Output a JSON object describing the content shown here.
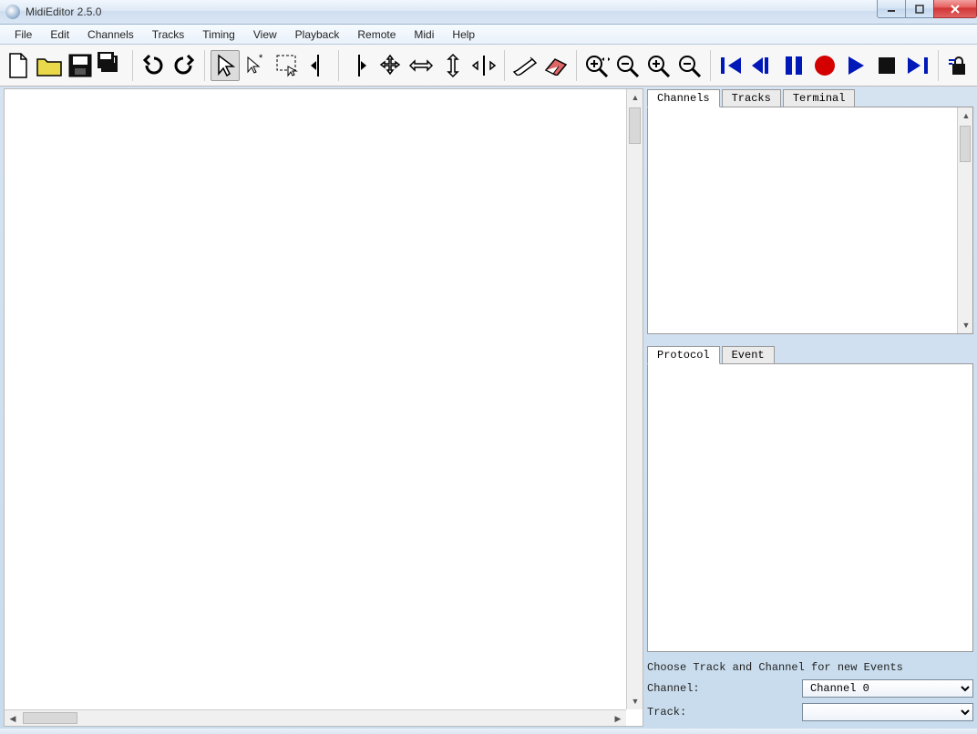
{
  "window": {
    "title": "MidiEditor 2.5.0"
  },
  "menu": [
    "File",
    "Edit",
    "Channels",
    "Tracks",
    "Timing",
    "View",
    "Playback",
    "Remote",
    "Midi",
    "Help"
  ],
  "toolbar": {
    "groups": [
      [
        "new",
        "open",
        "save",
        "save-all"
      ],
      [
        "undo",
        "redo"
      ],
      [
        "select",
        "select-add",
        "select-box",
        "select-left",
        "select-right"
      ],
      [
        "move",
        "move-h",
        "move-v",
        "move-cross"
      ],
      [
        "pencil",
        "eraser"
      ],
      [
        "zoom-in-h",
        "zoom-out-h",
        "zoom-in-v",
        "zoom-out-v"
      ],
      [
        "skip-start",
        "step-back",
        "pause",
        "record",
        "play",
        "stop",
        "skip-end"
      ],
      [
        "lock"
      ]
    ],
    "active": "select"
  },
  "tabs_upper": [
    "Channels",
    "Tracks",
    "Terminal"
  ],
  "tabs_upper_active": "Channels",
  "tabs_lower": [
    "Protocol",
    "Event"
  ],
  "tabs_lower_active": "Protocol",
  "form": {
    "caption": "Choose Track and Channel for new Events",
    "channel_label": "Channel:",
    "track_label": "Track:",
    "channel_value": "Channel 0",
    "track_value": ""
  }
}
